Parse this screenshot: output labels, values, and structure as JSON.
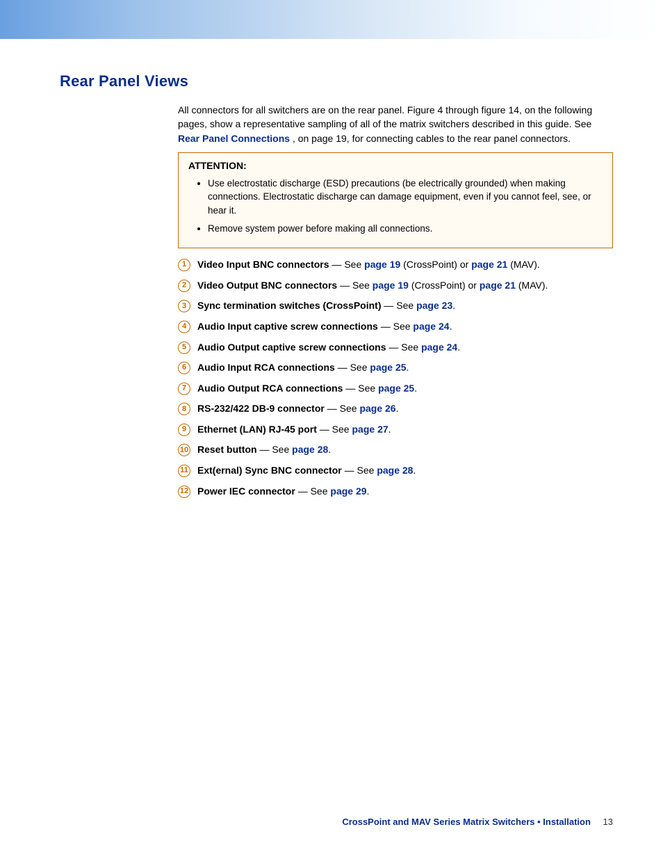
{
  "header": {
    "title": "Rear Panel Views"
  },
  "intro": {
    "p_a": "All connectors for all switchers are on the rear panel. Figure 4 through figure 14, on the following pages, show a representative sampling of all of the matrix switchers described in this guide. See ",
    "link": "Rear Panel Connections",
    "p_b": ", on page 19, for connecting cables to the rear panel connectors."
  },
  "attention": {
    "label": "ATTENTION",
    "items": [
      "Use electrostatic discharge (ESD) precautions (be electrically grounded) when making connections. Electrostatic discharge can damage equipment, even if you cannot feel, see, or hear it.",
      "Remove system power before making all connections."
    ]
  },
  "callouts": [
    {
      "n": "1",
      "bold": "Video Input BNC connectors",
      "mid": " — See ",
      "link1": "page 19",
      "between": " (CrossPoint) or ",
      "link2": "page 21",
      "suffix": " (MAV)."
    },
    {
      "n": "2",
      "bold": "Video Output BNC connectors",
      "mid": " — See ",
      "link1": "page 19",
      "between": " (CrossPoint) or ",
      "link2": "page 21",
      "suffix": " (MAV)."
    },
    {
      "n": "3",
      "bold": "Sync termination switches (CrossPoint)",
      "mid": " — See ",
      "link1": "page 23",
      "suffix": "."
    },
    {
      "n": "4",
      "bold": "Audio Input captive screw connections",
      "mid": " — See ",
      "link1": "page 24",
      "suffix": "."
    },
    {
      "n": "5",
      "bold": "Audio Output captive screw connections",
      "mid": " — See ",
      "link1": "page 24",
      "suffix": "."
    },
    {
      "n": "6",
      "bold": "Audio Input RCA connections",
      "mid": " — See ",
      "link1": "page 25",
      "suffix": "."
    },
    {
      "n": "7",
      "bold": "Audio Output RCA connections",
      "mid": " — See ",
      "link1": "page 25",
      "suffix": "."
    },
    {
      "n": "8",
      "bold": "RS-232/422 DB-9 connector",
      "mid": " — See ",
      "link1": "page 26",
      "suffix": "."
    },
    {
      "n": "9",
      "bold": "Ethernet (LAN) RJ-45 port",
      "mid": " — See ",
      "link1": "page 27",
      "suffix": "."
    },
    {
      "n": "10",
      "bold": "Reset button",
      "mid": " — See ",
      "link1": "page 28",
      "suffix": "."
    },
    {
      "n": "11",
      "bold": "Ext(ernal) Sync BNC connector",
      "mid": " — See ",
      "link1": "page 28",
      "suffix": "."
    },
    {
      "n": "12",
      "bold": "Power IEC connector",
      "mid": " — See ",
      "link1": "page 29",
      "suffix": "."
    }
  ],
  "footer": {
    "text": "CrossPoint and MAV Series Matrix Switchers • Installation",
    "page": "13"
  }
}
